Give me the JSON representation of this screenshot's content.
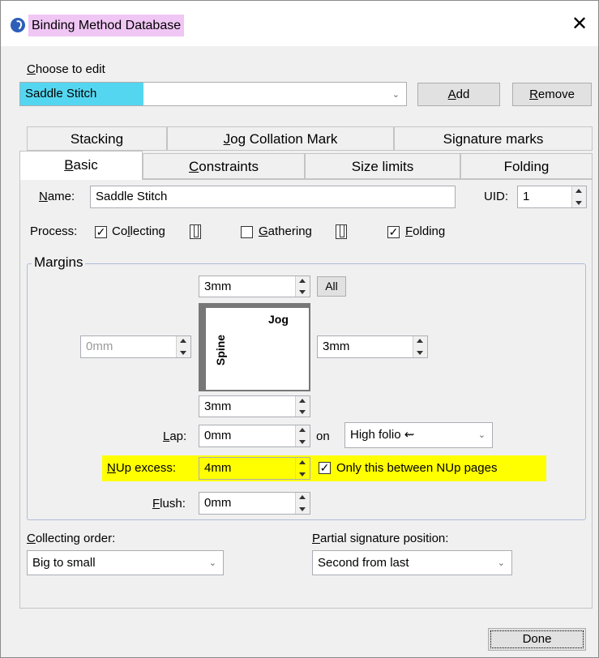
{
  "window": {
    "title": "Binding Method Database",
    "close": "✕"
  },
  "choose": {
    "label_pre": "",
    "label_u": "C",
    "label_post": "hoose to edit",
    "value": "Saddle Stitch",
    "add_u": "A",
    "add_post": "dd",
    "remove_pre": "",
    "remove_u": "R",
    "remove_post": "emove"
  },
  "tabs": {
    "row1": [
      "Stacking",
      "Jog Collation Mark",
      "Signature marks"
    ],
    "row1_jog_pre": "",
    "row1_jog_u": "J",
    "row1_jog_post": "og Collation Mark",
    "row2": {
      "basic_pre": "",
      "basic_u": "B",
      "basic_post": "asic",
      "constraints_pre": "",
      "constraints_u": "C",
      "constraints_post": "onstraints",
      "size_limits": "Size limits",
      "folding": "Folding"
    }
  },
  "basic": {
    "name_u": "N",
    "name_post": "ame:",
    "name_value": "Saddle Stitch",
    "uid_label": "UID:",
    "uid_value": "1",
    "process_label": "Process:",
    "collecting_pre": "Co",
    "collecting_u": "l",
    "collecting_post": "lecting",
    "collecting_checked": "✓",
    "gathering_u": "G",
    "gathering_post": "athering",
    "folding_u": "F",
    "folding_post": "olding",
    "folding_checked": "✓",
    "margins": {
      "legend": "Margins",
      "top": "3mm",
      "all_button": "All",
      "left": "0mm",
      "right": "3mm",
      "bottom": "3mm",
      "jog_label": "Jog",
      "spine_label": "Spine",
      "lap_u": "L",
      "lap_post": "ap:",
      "lap_value": "0mm",
      "on_label": "on",
      "lap_side": "High folio",
      "nup_u": "N",
      "nup_post": "Up excess:",
      "nup_value": "4mm",
      "only_between": "Only this between NUp pages",
      "only_checked": "✓",
      "flush_u": "F",
      "flush_post": "lush:",
      "flush_value": "0mm"
    },
    "collecting_order_u": "C",
    "collecting_order_post": "ollecting order:",
    "collecting_order_value": "Big to small",
    "partial_u": "P",
    "partial_post": "artial signature position:",
    "partial_value": "Second from last"
  },
  "done_label": "Done",
  "colors": {
    "title_highlight": "#f0c6f5",
    "selected_value": "#55d6f0",
    "nup_highlight": "#ffff00"
  }
}
